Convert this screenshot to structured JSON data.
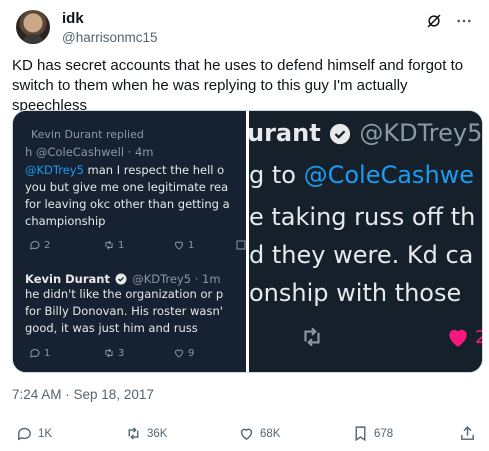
{
  "author": {
    "name": "idk",
    "handle": "@harrisonmc15"
  },
  "tweet": {
    "text": "KD has secret accounts that he uses to defend himself and forgot to switch to them when he was replying to this guy I'm actually speechless",
    "timestamp": "7:24 AM · Sep 18, 2017"
  },
  "embedded_left": {
    "replied_label": "Kevin Durant replied",
    "first_handle_line": "h @ColeCashwell · 4m",
    "first_mention": "@KDTrey5",
    "first_text_1": " man I respect the hell o",
    "first_text_2": "you but give me one legitimate rea",
    "first_text_3": "for leaving okc other than getting a",
    "first_text_4": "championship",
    "first_counts": {
      "replies": "2",
      "retweets": "1",
      "likes": "1"
    },
    "second_name": "Kevin Durant",
    "second_handle_line": "@KDTrey5 · 1m",
    "second_text_1": "he didn't like the organization or p",
    "second_text_2": "for Billy Donovan. His roster wasn'",
    "second_text_3": "good, it was just him and russ",
    "second_counts": {
      "replies": "1",
      "retweets": "3",
      "likes": "9"
    }
  },
  "embedded_right": {
    "line1_name": "urant",
    "line1_handle": "@KDTrey5",
    "line2_prefix": "g to ",
    "line2_mention": "@ColeCashwe",
    "line3": "e taking russ off th",
    "line4": "d they were. Kd ca",
    "line5": "onship with those",
    "like_count": "2"
  },
  "actions": {
    "replies": "1K",
    "retweets": "36K",
    "likes": "68K",
    "bookmarks": "678"
  },
  "colors": {
    "accent_blue": "#1d9bf0",
    "like_red": "#f91880",
    "dark_bg": "#15202b"
  }
}
